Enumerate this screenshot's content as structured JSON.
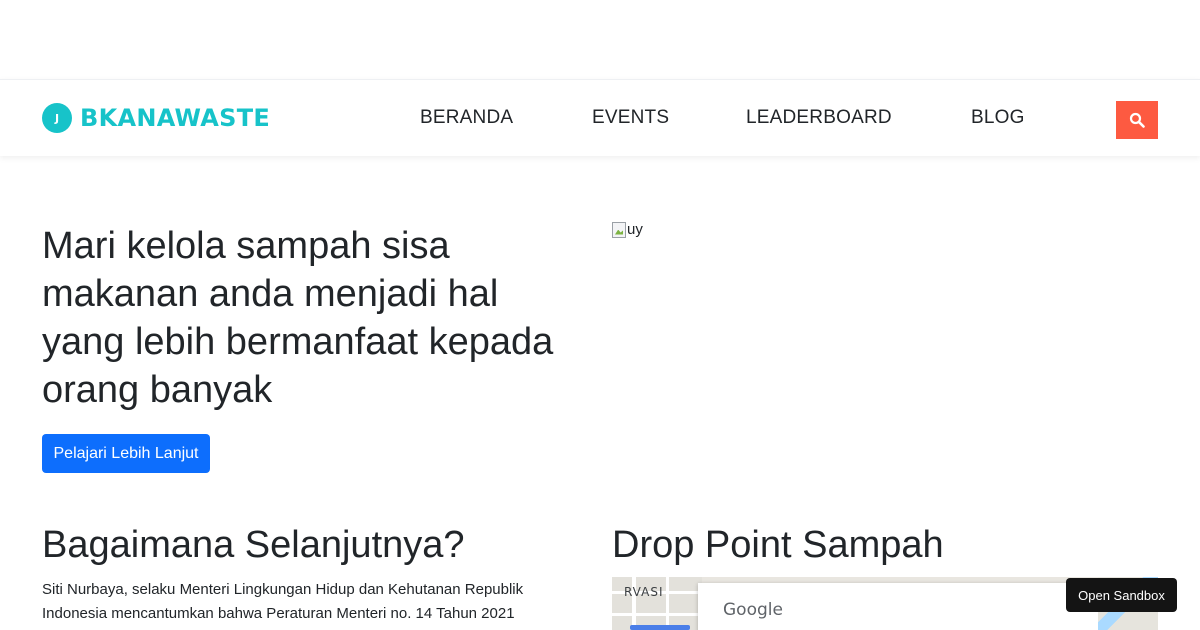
{
  "navbar": {
    "brand_badge": "J",
    "brand_name": "BKANAWASTE",
    "links": [
      {
        "label": "BERANDA"
      },
      {
        "label": "EVENTS"
      },
      {
        "label": "LEADERBOARD"
      },
      {
        "label": "BLOG"
      }
    ],
    "search_icon": "search-icon",
    "search_color": "#fd5a41",
    "brand_color": "#17c3c9"
  },
  "hero": {
    "title": "Mari kelola sampah sisa makanan anda menjadi hal yang lebih bermanfaat kepada orang banyak",
    "cta_label": "Pelajari Lebih Lanjut",
    "cta_color": "#0d6efd",
    "image_alt": "uy"
  },
  "next_section": {
    "title": "Bagaimana Selanjutnya?",
    "text": "Siti Nurbaya, selaku Menteri Lingkungan Hidup dan Kehutanan Republik Indonesia mencantumkan bahwa Peraturan Menteri no. 14 Tahun 2021"
  },
  "drop_point": {
    "title": "Drop Point Sampah",
    "map_label": "RVASI",
    "map_brand": "Google"
  },
  "sandbox": {
    "label": "Open Sandbox"
  }
}
